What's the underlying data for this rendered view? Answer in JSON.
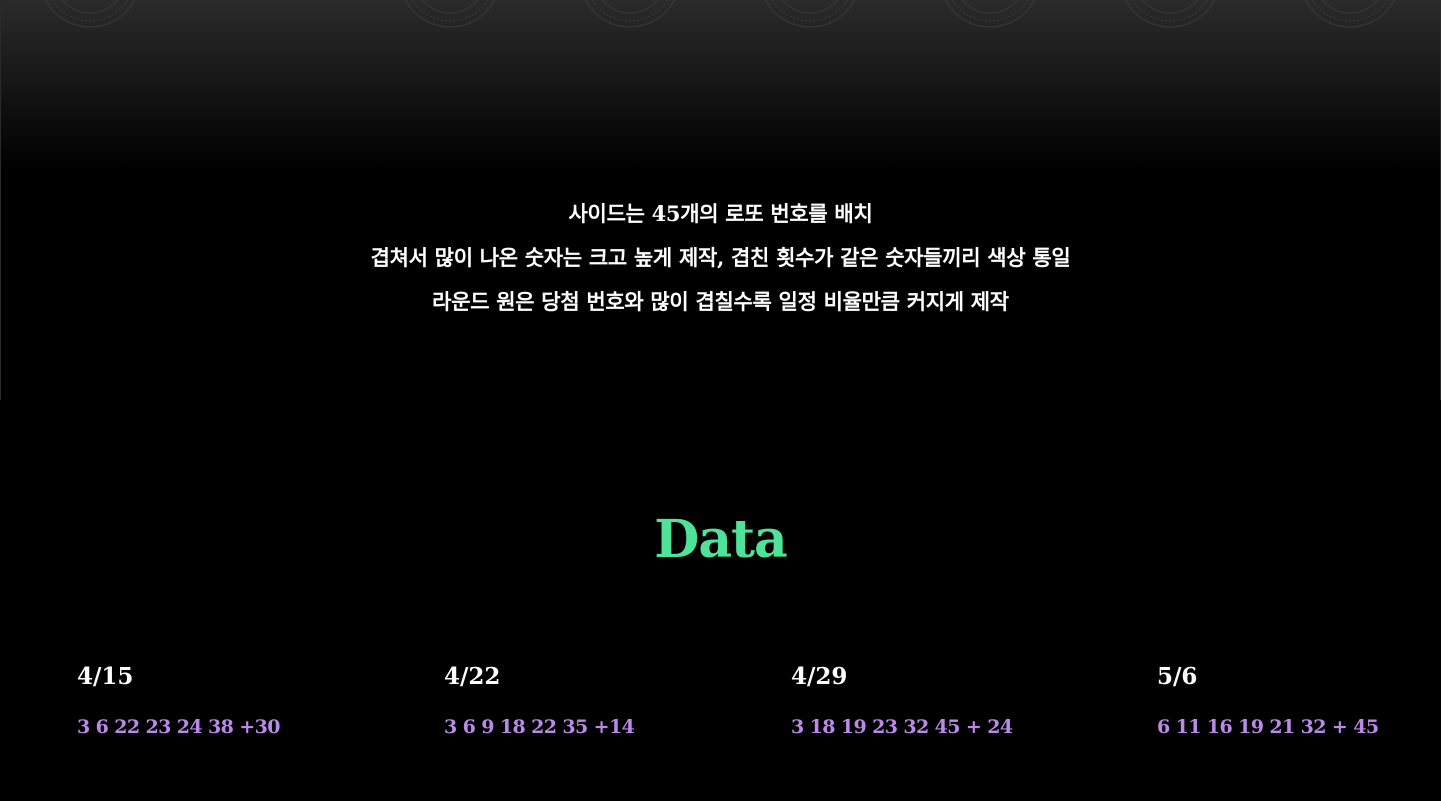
{
  "intro": {
    "lines": [
      "사이드는 45개의 로또 번호를 배치",
      "겹쳐서 많이 나온 숫자는 크고 높게 제작, 겹친 횟수가 같은 숫자들끼리 색상 통일",
      "라운드 원은 당첨 번호와 많이 겹칠수록 일정 비율만큼 커지게 제작"
    ]
  },
  "section": {
    "title": "Data"
  },
  "rounds": [
    {
      "date": "4/15",
      "numbers": "3 6 22 23 24 38 +30"
    },
    {
      "date": "4/22",
      "numbers": "3 6 9 18 22 35 +14"
    },
    {
      "date": "4/29",
      "numbers": "3 18 19 23 32 45 + 24"
    },
    {
      "date": "5/6",
      "numbers": "6 11 16 19 21 32 + 45"
    }
  ],
  "colors": {
    "title": "#4fe39a",
    "numbers": "#b98ae8",
    "text": "#ffffff",
    "background": "#000000"
  },
  "icons": {
    "decoration": "rosette-icon"
  }
}
